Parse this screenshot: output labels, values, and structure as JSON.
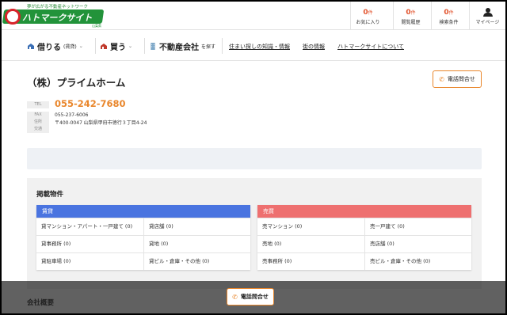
{
  "header": {
    "logo": {
      "tagline": "夢が広がる不動産ネットワーク",
      "name": "ハトマークサイト",
      "sub": "山梨県"
    },
    "stats": [
      {
        "count": "0",
        "unit": "件",
        "label": "お気に入り"
      },
      {
        "count": "0",
        "unit": "件",
        "label": "閲覧履歴"
      },
      {
        "count": "0",
        "unit": "件",
        "label": "検索条件"
      }
    ],
    "mypage_label": "マイページ"
  },
  "nav": {
    "rent": {
      "label": "借りる",
      "sub": "(賃貸)"
    },
    "buy": {
      "label": "買う"
    },
    "agency": {
      "label": "不動産会社",
      "sub": "を探す"
    },
    "links": [
      "住まい探しの知識・情報",
      "街の情報",
      "ハトマークサイトについて"
    ]
  },
  "company": {
    "name": "（株）プライムホーム",
    "call_button": "電話問合せ",
    "info": {
      "tel_key": "TEL",
      "tel": "055-242-7680",
      "fax_key": "FAX",
      "fax": "055-237-6006",
      "address_key": "住所",
      "address": "〒400-0047 山梨県甲府市徳行３丁目4-24",
      "access_key": "交通",
      "access": ""
    }
  },
  "listings": {
    "title": "掲載物件",
    "rent": {
      "header": "賃貸",
      "color": "#4a74e0",
      "items": [
        "貸マンション・アパート・一戸建て (0)",
        "貸店舗 (0)",
        "貸事務所 (0)",
        "貸地 (0)",
        "貸駐車場 (0)",
        "貸ビル・倉庫・その他 (0)"
      ]
    },
    "sale": {
      "header": "売買",
      "color": "#ee7070",
      "items": [
        "売マンション (0)",
        "売一戸建て (0)",
        "売地 (0)",
        "売店舗 (0)",
        "売事務所 (0)",
        "売ビル・倉庫・その他 (0)"
      ]
    }
  },
  "overview_title": "会社概要",
  "bottom_call_button": "電話問合せ",
  "colors": {
    "accent": "#e9862b",
    "brand_green": "#22933a",
    "count_red": "#e2522b"
  }
}
